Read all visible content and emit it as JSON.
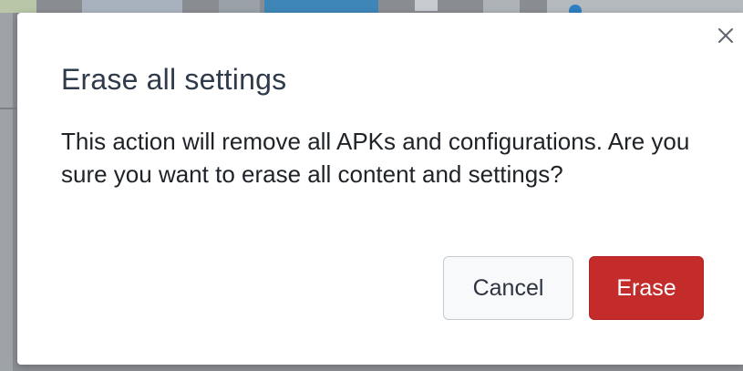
{
  "dialog": {
    "title": "Erase all settings",
    "message": "This action will remove all APKs and configurations. Are you sure you want to erase all content and settings?",
    "cancel_label": "Cancel",
    "erase_label": "Erase",
    "close_icon": "close-icon"
  },
  "colors": {
    "erase_button_bg": "#c42b2b",
    "title_text": "#2f3b4a",
    "backdrop": "#8a8d92"
  }
}
